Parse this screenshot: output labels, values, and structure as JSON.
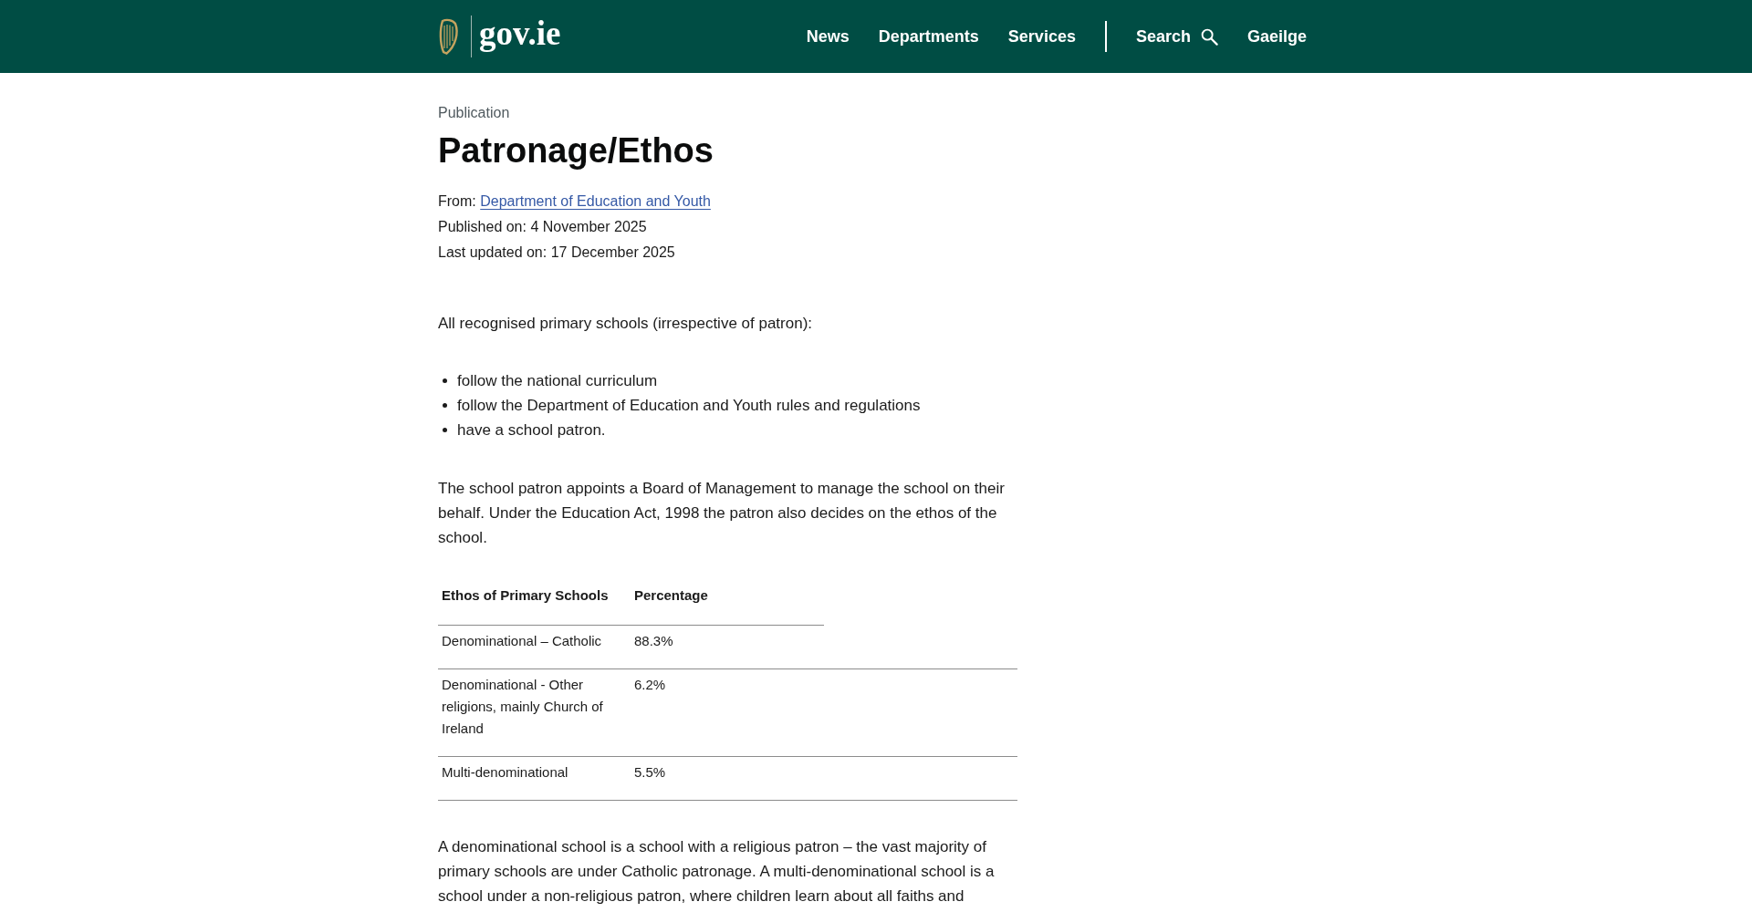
{
  "header": {
    "logo_text": "gov.ie",
    "nav": [
      "News",
      "Departments",
      "Services"
    ],
    "search": {
      "label": "Search"
    },
    "language_link": {
      "label": "Gaeilge"
    }
  },
  "page": {
    "type_label": "Publication",
    "title": "Patronage/Ethos",
    "meta": [
      {
        "kind": "link",
        "label": "From:",
        "link": "Department of Education and Youth"
      },
      {
        "kind": "text",
        "text": "Published on: 4 November 2025"
      },
      {
        "kind": "text",
        "text": "Last updated on: 17 December 2025"
      }
    ]
  },
  "content": [
    {
      "kind": "paragraph",
      "text": "All recognised primary schools (irrespective of patron):"
    },
    {
      "kind": "list",
      "items": [
        "follow the national curriculum",
        "follow the Department of Education and Youth rules and regulations",
        "have a school patron."
      ]
    },
    {
      "kind": "paragraph",
      "text": "The school patron appoints a Board of Management to manage the school on their behalf. Under the Education Act, 1998 the patron also decides on the ethos of the school."
    },
    {
      "kind": "table",
      "columns": [
        "Ethos of Primary Schools",
        "Percentage"
      ],
      "rows": [
        [
          "Denominational – Catholic",
          "88.3%"
        ],
        [
          "Denominational - Other religions, mainly Church of Ireland",
          "6.2%"
        ],
        [
          "Multi-denominational",
          "5.5%"
        ]
      ]
    },
    {
      "kind": "paragraph",
      "text": "A denominational school is a school with a religious patron – the vast majority of primary schools are under Catholic patronage. A multi-denominational school is a school under a non-religious patron, where children learn about all faiths and"
    }
  ]
}
